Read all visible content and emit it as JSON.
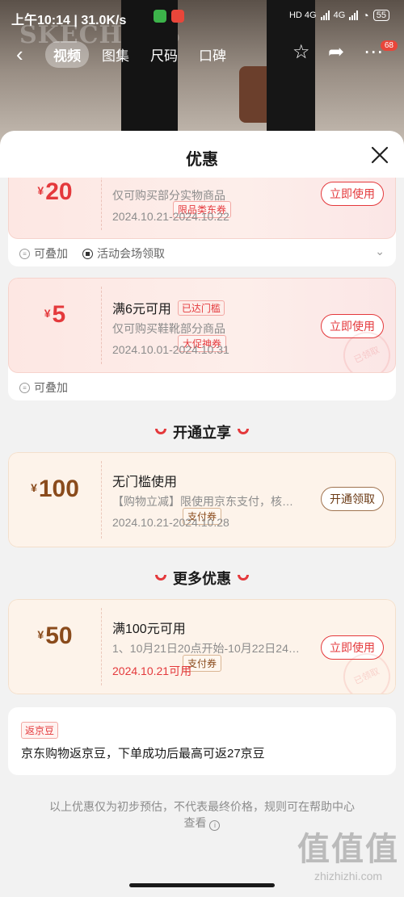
{
  "status_bar": {
    "time": "上午10:14",
    "speed": "31.0K/s",
    "network_1": "HD 4G",
    "network_2": "4G",
    "battery": "55"
  },
  "background": {
    "brand_text": "SKECHERS"
  },
  "top_nav": {
    "tabs": [
      {
        "label": "视频",
        "active": true
      },
      {
        "label": "图集",
        "active": false
      },
      {
        "label": "尺码",
        "active": false
      },
      {
        "label": "口碑",
        "active": false
      }
    ],
    "message_badge": "68"
  },
  "sheet": {
    "title": "优惠",
    "coupons": [
      {
        "currency": "¥",
        "amount": "20",
        "tag": "限品类东券",
        "desc": "仅可购买部分实物商品",
        "date": "2024.10.21-2024.10.22",
        "button": "立即使用",
        "footer": [
          "可叠加",
          "活动会场领取"
        ]
      },
      {
        "currency": "¥",
        "amount": "5",
        "tag": "大促神券",
        "title": "满6元可用",
        "badge": "已达门槛",
        "desc": "仅可购买鞋靴部分商品",
        "date": "2024.10.01-2024.10.31",
        "button": "立即使用",
        "stamp": "已领取",
        "footer": [
          "可叠加"
        ]
      }
    ],
    "section_open": "开通立享",
    "open_coupon": {
      "currency": "¥",
      "amount": "100",
      "tag": "支付券",
      "title": "无门槛使用",
      "desc": "【购物立减】限使用京东支付，核…",
      "date": "2024.10.21-2024.10.28",
      "button": "开通领取"
    },
    "section_more": "更多优惠",
    "more_coupon": {
      "currency": "¥",
      "amount": "50",
      "tag": "支付券",
      "title": "满100元可用",
      "desc": "1、10月21日20点开始-10月22日24…",
      "date": "2024.10.21可用",
      "button": "立即使用",
      "stamp": "已领取"
    },
    "bean": {
      "label": "返京豆",
      "text": "京东购物返京豆，下单成功后最高可返27京豆"
    },
    "note": "以上优惠仅为初步预估，不代表最终价格，规则可在帮助中心查看"
  },
  "watermark": {
    "big": "值值值",
    "small": "zhizhizhi.com"
  }
}
